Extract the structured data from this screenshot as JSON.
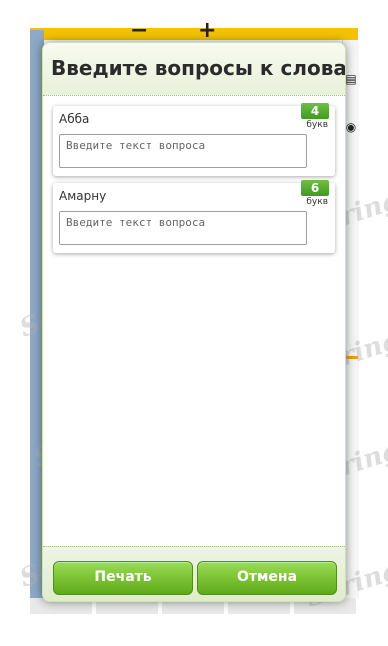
{
  "dialog": {
    "title": "Введите вопросы к словам",
    "words": [
      {
        "word": "Абба",
        "letters": "4",
        "unit": "букв",
        "placeholder": "Введите текст вопроса"
      },
      {
        "word": "Амарну",
        "letters": "6",
        "unit": "букв",
        "placeholder": "Введите текст вопроса"
      }
    ],
    "buttons": {
      "print": "Печать",
      "cancel": "Отмена"
    }
  },
  "background": {
    "zoom_minus": "−",
    "zoom_plus": "+",
    "print_icon": "printer-icon",
    "view_icon": "eye-icon"
  },
  "watermark": "Soringpcrepair.com",
  "colors": {
    "accent_green": "#5faa19",
    "badge_green": "#3f9a1e",
    "topbar_yellow": "#f3c300",
    "strip_blue": "#8ea9c7"
  }
}
